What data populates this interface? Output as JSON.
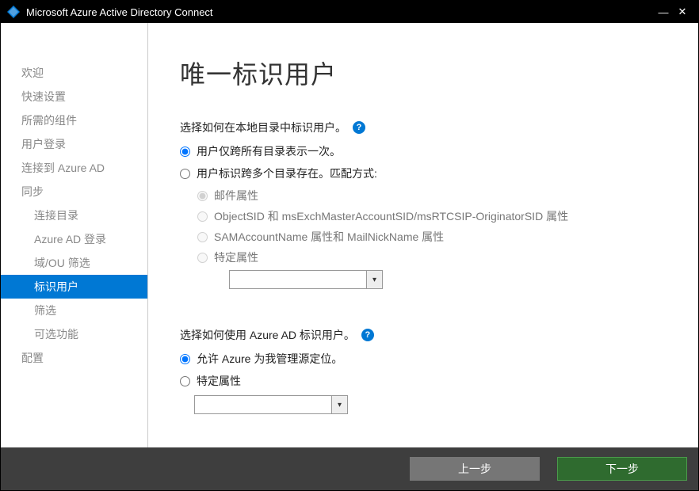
{
  "titlebar": {
    "title": "Microsoft Azure Active Directory Connect"
  },
  "sidebar": {
    "items": [
      {
        "label": "欢迎"
      },
      {
        "label": "快速设置"
      },
      {
        "label": "所需的组件"
      },
      {
        "label": "用户登录"
      },
      {
        "label": "连接到 Azure AD"
      },
      {
        "label": "同步"
      },
      {
        "label": "连接目录"
      },
      {
        "label": "Azure AD 登录"
      },
      {
        "label": "域/OU 筛选"
      },
      {
        "label": "标识用户"
      },
      {
        "label": "筛选"
      },
      {
        "label": "可选功能"
      },
      {
        "label": "配置"
      }
    ]
  },
  "main": {
    "heading": "唯一标识用户",
    "section1_label": "选择如何在本地目录中标识用户。",
    "opt_once": "用户仅跨所有目录表示一次。",
    "opt_multi": "用户标识跨多个目录存在。匹配方式:",
    "sub_mail": "邮件属性",
    "sub_objectsid": "ObjectSID 和 msExchMasterAccountSID/msRTCSIP-OriginatorSID 属性",
    "sub_sam": "SAMAccountName 属性和 MailNickName 属性",
    "sub_specific1": "特定属性",
    "section2_label": "选择如何使用 Azure AD 标识用户。",
    "opt_allow_azure": "允许 Azure 为我管理源定位。",
    "opt_specific2": "特定属性"
  },
  "footer": {
    "prev": "上一步",
    "next": "下一步"
  }
}
